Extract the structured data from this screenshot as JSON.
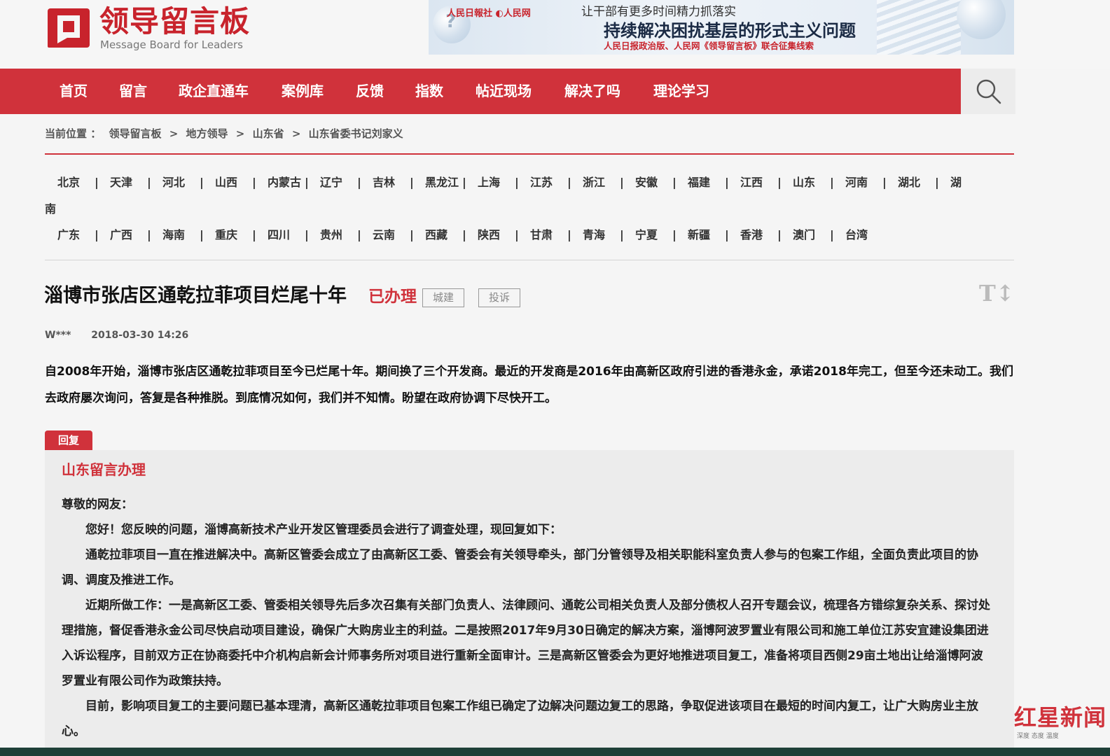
{
  "site": {
    "logo_cn": "领导留言板",
    "logo_en": "Message Board for Leaders"
  },
  "banner": {
    "logos": "人民日報社 ◐人民网",
    "line1": "让干部有更多时间精力抓落实",
    "line2": "持续解决困扰基层的形式主义问题",
    "line3": "人民日报政治版、人民网《领导留言板》联合征集线索"
  },
  "nav": {
    "items": [
      "首页",
      "留言",
      "政企直通车",
      "案例库",
      "反馈",
      "指数",
      "帖近现场",
      "解决了吗",
      "理论学习"
    ]
  },
  "breadcrumb": {
    "label": "当前位置 ：",
    "items": [
      "领导留言板",
      "地方领导",
      "山东省",
      "山东省委书记刘家义"
    ],
    "separator": ">"
  },
  "provinces": {
    "row1": [
      "北京",
      "天津",
      "河北",
      "山西",
      "内蒙古",
      "辽宁",
      "吉林",
      "黑龙江",
      "上海",
      "江苏",
      "浙江",
      "安徽",
      "福建",
      "江西",
      "山东",
      "河南",
      "湖北",
      "湖"
    ],
    "row1_wrap": "南",
    "row2": [
      "广东",
      "广西",
      "海南",
      "重庆",
      "四川",
      "贵州",
      "云南",
      "西藏",
      "陕西",
      "甘肃",
      "青海",
      "宁夏",
      "新疆",
      "香港",
      "澳门",
      "台湾"
    ],
    "separator": "|"
  },
  "message": {
    "title": "淄博市张店区通乾拉菲项目烂尾十年",
    "status": "已办理",
    "tags": [
      "城建",
      "投诉"
    ],
    "font_icon": "T↕",
    "author": "W***",
    "time": "2018-03-30 14:26",
    "body": "自2008年开始，淄博市张店区通乾拉菲项目至今已烂尾十年。期间换了三个开发商。最近的开发商是2016年由高新区政府引进的香港永金，承诺2018年完工，但至今还未动工。我们去政府屡次询问，答复是各种推脱。到底情况如何，我们并不知情。盼望在政府协调下尽快开工。"
  },
  "reply": {
    "tab": "回复",
    "org": "山东留言办理",
    "greeting": "尊敬的网友：",
    "p1": "您好！您反映的问题，淄博高新技术产业开发区管理委员会进行了调查处理，现回复如下：",
    "p2": "通乾拉菲项目一直在推进解决中。高新区管委会成立了由高新区工委、管委会有关领导牵头，部门分管领导及相关职能科室负责人参与的包案工作组，全面负责此项目的协调、调度及推进工作。",
    "p3": "近期所做工作：一是高新区工委、管委相关领导先后多次召集有关部门负责人、法律顾问、通乾公司相关负责人及部分债权人召开专题会议，梳理各方错综复杂关系、探讨处理措施，督促香港永金公司尽快启动项目建设，确保广大购房业主的利益。二是按照2017年9月30日确定的解决方案，淄博阿波罗置业有限公司和施工单位江苏安宜建设集团进入诉讼程序，目前双方正在协商委托中介机构启新会计师事务所对项目进行重新全面审计。三是高新区管委会为更好地推进项目复工，准备将项目西侧29亩土地出让给淄博阿波罗置业有限公司作为政策扶持。",
    "p4": "目前，影响项目复工的主要问题已基本理清，高新区通乾拉菲项目包案工作组已确定了边解决问题边复工的思路，争取促进该项目在最短的时间内复工，让广大购房业主放心。"
  },
  "watermark": {
    "text": "红星新闻",
    "sub": "深度 态度 温度"
  },
  "colors": {
    "brand_red": "#d0323b",
    "footer_bar": "#1e4038"
  }
}
